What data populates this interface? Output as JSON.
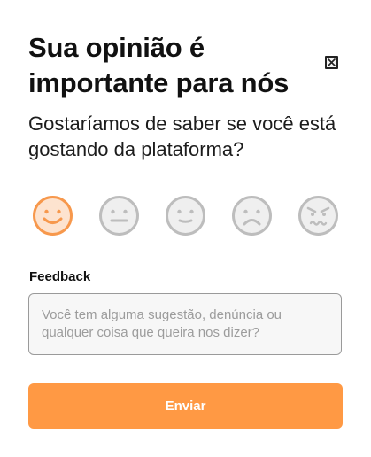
{
  "dialog": {
    "title": "Sua opinião é importante para nós",
    "subtitle": "Gostaríamos de saber se você está gostando da plataforma?",
    "close_icon": "close-icon"
  },
  "rating": {
    "options": [
      {
        "icon": "smiling-face-icon",
        "selected": true
      },
      {
        "icon": "neutral-face-icon",
        "selected": false
      },
      {
        "icon": "slightly-smiling-face-icon",
        "selected": false
      },
      {
        "icon": "frowning-face-icon",
        "selected": false
      },
      {
        "icon": "angry-face-icon",
        "selected": false
      }
    ]
  },
  "feedback": {
    "label": "Feedback",
    "placeholder": "Você tem alguma sugestão, denúncia ou qualquer coisa que queira nos dizer?",
    "value": ""
  },
  "submit": {
    "label": "Enviar"
  },
  "colors": {
    "accent": "#ff9944",
    "selected_face_fill": "#fde3cf",
    "selected_face_stroke": "#f7984c",
    "unselected_face_fill": "#efefef",
    "unselected_face_stroke": "#bdbdbd"
  }
}
